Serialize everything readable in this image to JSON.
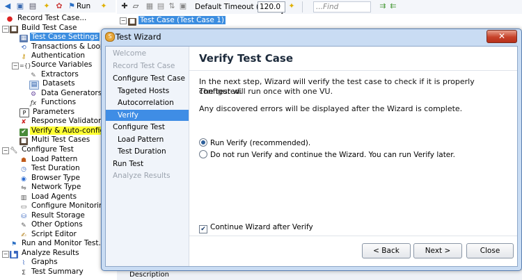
{
  "left_toolbar": {
    "run_label": "Run"
  },
  "tree": {
    "items": [
      {
        "label": "Record Test Case..."
      },
      {
        "label": "Build Test Case"
      },
      {
        "label": "Test Case Settings"
      },
      {
        "label": "Transactions & Loops"
      },
      {
        "label": "Authentication"
      },
      {
        "label": "Source Variables"
      },
      {
        "label": "Extractors"
      },
      {
        "label": "Datasets"
      },
      {
        "label": "Data Generators"
      },
      {
        "label": "Functions"
      },
      {
        "label": "Parameters"
      },
      {
        "label": "Response Validators"
      },
      {
        "label": "Verify & Auto-config"
      },
      {
        "label": "Multi Test Cases"
      },
      {
        "label": "Configure Test"
      },
      {
        "label": "Load Pattern"
      },
      {
        "label": "Test Duration"
      },
      {
        "label": "Browser Type"
      },
      {
        "label": "Network Type"
      },
      {
        "label": "Load Agents"
      },
      {
        "label": "Configure Monitoring"
      },
      {
        "label": "Result Storage"
      },
      {
        "label": "Other Options"
      },
      {
        "label": "Script Editor"
      },
      {
        "label": "Run and Monitor Test..."
      },
      {
        "label": "Analyze Results"
      },
      {
        "label": "Graphs"
      },
      {
        "label": "Test Summary"
      }
    ]
  },
  "right_toolbar": {
    "timeout_label": "Default Timeout (s):",
    "timeout_value": "120.0",
    "find_placeholder": "...Find"
  },
  "bg_tree": {
    "root_label": "Test Case (Test Case 1)",
    "column_label": "Description"
  },
  "dialog": {
    "title": "Test Wizard",
    "close_glyph": "✕",
    "steps": [
      {
        "label": "Welcome",
        "state": "disabled"
      },
      {
        "label": "Record Test Case",
        "state": "disabled"
      },
      {
        "label": "Configure Test Case",
        "state": "normal"
      },
      {
        "label": "Tageted Hosts",
        "state": "normal"
      },
      {
        "label": "Autocorrelation",
        "state": "normal"
      },
      {
        "label": "Verify",
        "state": "current"
      },
      {
        "label": "Configure Test",
        "state": "normal"
      },
      {
        "label": "Load Pattern",
        "state": "normal"
      },
      {
        "label": "Test Duration",
        "state": "normal"
      },
      {
        "label": "Run Test",
        "state": "normal"
      },
      {
        "label": "Analyze Results",
        "state": "disabled"
      }
    ],
    "heading": "Verify Test Case",
    "para1_line1": "In the next step, Wizard will verify the test case to check if it is properly configured.",
    "para1_line2": "The test will run once with one VU.",
    "para2": "Any discovered errors will be displayed after the Wizard is complete.",
    "option_run_verify": "Run Verify (recommended).",
    "option_skip_verify": "Do not run Verify and continue the Wizard. You can run Verify later.",
    "checkbox_continue": "Continue Wizard after Verify",
    "buttons": {
      "back": "< Back",
      "next": "Next >",
      "close": "Close"
    }
  },
  "colors": {
    "selection_blue": "#3b8de0",
    "highlight_yellow": "#ffff33",
    "dialog_frame": "#c9dcf3",
    "close_red": "#c7432b"
  }
}
